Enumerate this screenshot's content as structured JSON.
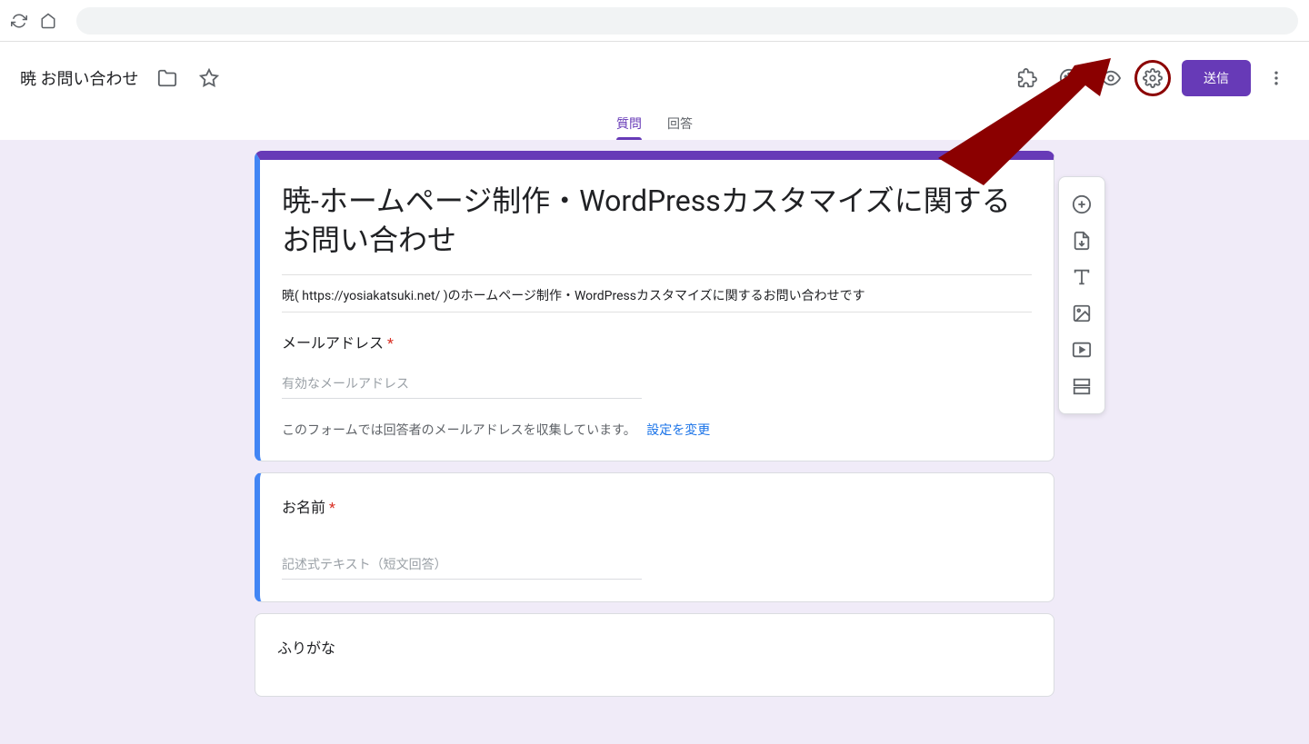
{
  "browser": {},
  "header": {
    "doc_title": "暁 お問い合わせ",
    "send_label": "送信"
  },
  "tabs": {
    "questions": "質問",
    "responses": "回答"
  },
  "form": {
    "title": "暁-ホームページ制作・WordPressカスタマイズに関するお問い合わせ",
    "description": "暁( https://yosiakatsuki.net/ )のホームページ制作・WordPressカスタマイズに関するお問い合わせです",
    "email_label": "メールアドレス",
    "email_placeholder": "有効なメールアドレス",
    "collect_note": "このフォームでは回答者のメールアドレスを収集しています。",
    "collect_link": "設定を変更",
    "q1_label": "お名前",
    "q1_placeholder": "記述式テキスト（短文回答）",
    "q2_label": "ふりがな"
  },
  "colors": {
    "accent": "#673ab7",
    "highlight": "#8b0000",
    "link": "#1a73e8"
  }
}
